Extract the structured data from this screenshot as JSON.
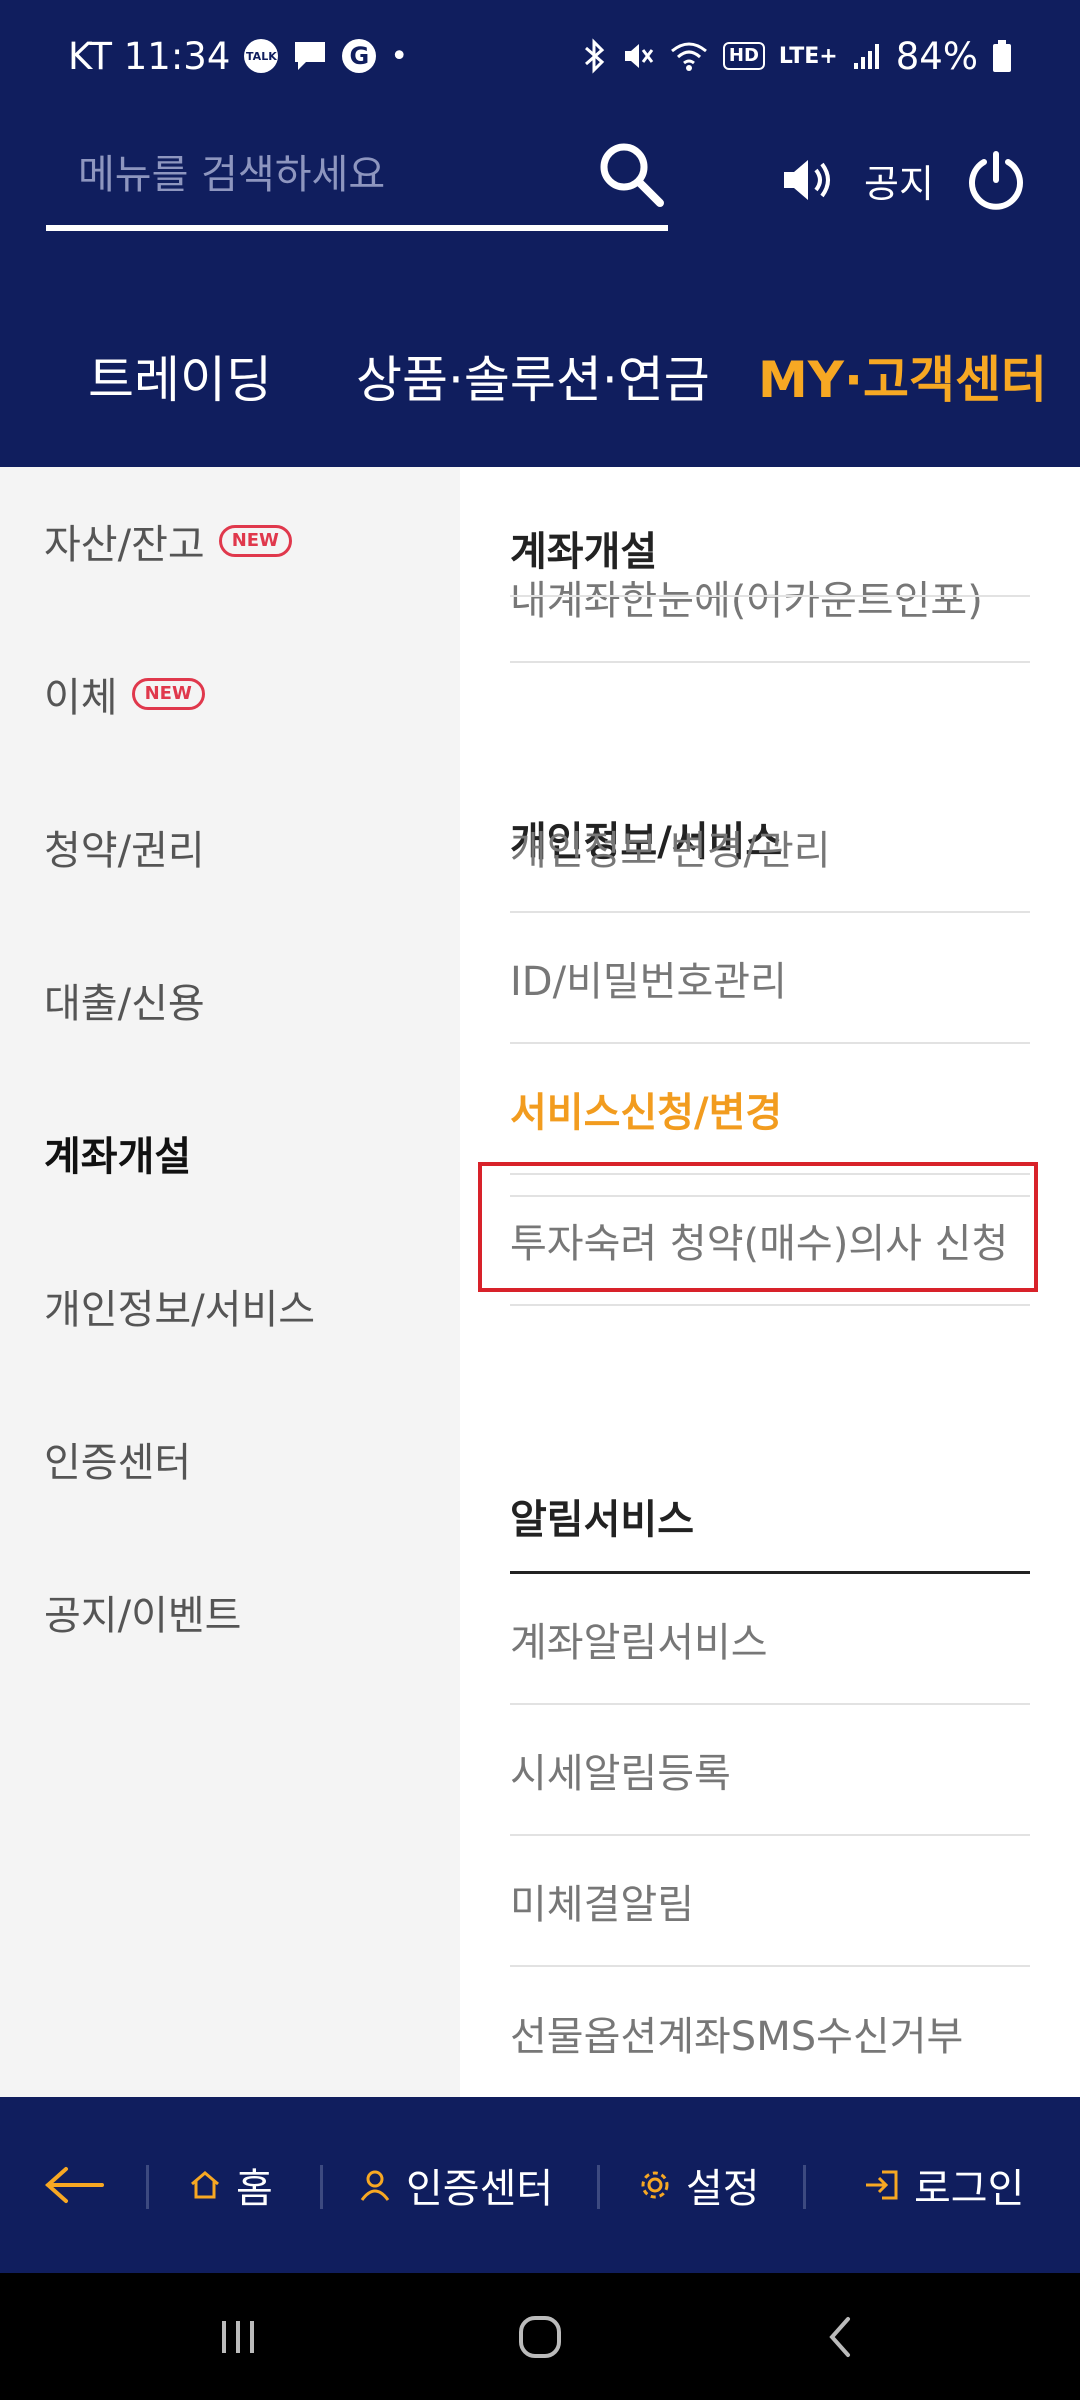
{
  "status_bar": {
    "carrier_time": "KT 11:34",
    "talk_label": "TALK",
    "g_label": "G",
    "dot": "•",
    "hd_label": "HD",
    "lte_label": "LTE+",
    "battery": "84%"
  },
  "search": {
    "placeholder": "메뉴를 검색하세요"
  },
  "header": {
    "notice_label": "공지"
  },
  "tabs": [
    {
      "label": "트레이딩"
    },
    {
      "label": "상품·솔루션·연금"
    },
    {
      "label": "MY·고객센터"
    }
  ],
  "left_menu": {
    "new_badge": "NEW",
    "items": [
      {
        "label": "자산/잔고"
      },
      {
        "label": "이체"
      },
      {
        "label": "청약/권리"
      },
      {
        "label": "대출/신용"
      },
      {
        "label": "계좌개설"
      },
      {
        "label": "개인정보/서비스"
      },
      {
        "label": "인증센터"
      },
      {
        "label": "공지/이벤트"
      }
    ]
  },
  "right_panel": {
    "sections": [
      {
        "title": "계좌개설",
        "items": [
          "내계좌한눈에(어카운트인포)"
        ]
      },
      {
        "title": "개인정보/서비스",
        "items": [
          "개인정보 변경/관리",
          "ID/비밀번호관리",
          "서비스신청/변경",
          "투자숙려 청약(매수)의사 신청"
        ]
      },
      {
        "title": "알림서비스",
        "items": [
          "계좌알림서비스",
          "시세알림등록",
          "미체결알림",
          "선물옵션계좌SMS수신거부"
        ]
      }
    ]
  },
  "bottom_nav": {
    "home": "홈",
    "cert": "인증센터",
    "settings": "설정",
    "login": "로그인"
  },
  "colors": {
    "navy": "#101e5e",
    "accent": "#f7a823",
    "highlight_border": "#d8222a",
    "new_badge": "#e0384c"
  }
}
